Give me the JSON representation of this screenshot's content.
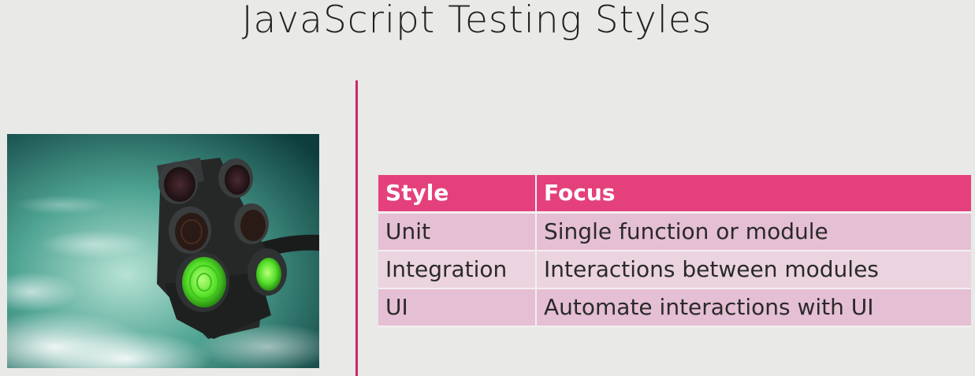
{
  "slide": {
    "title": "JavaScript Testing Styles"
  },
  "photo": {
    "subject": "traffic-light-icon"
  },
  "table": {
    "headers": [
      "Style",
      "Focus"
    ],
    "rows": [
      [
        "Unit",
        "Single function or module"
      ],
      [
        "Integration",
        "Interactions between modules"
      ],
      [
        "UI",
        "Automate interactions with UI"
      ]
    ]
  },
  "colors": {
    "accent": "#e4417c",
    "divider": "#c8286a",
    "row_odd": "#e5bfd4",
    "row_even": "#ebd4df",
    "background": "#e9e9e8"
  }
}
